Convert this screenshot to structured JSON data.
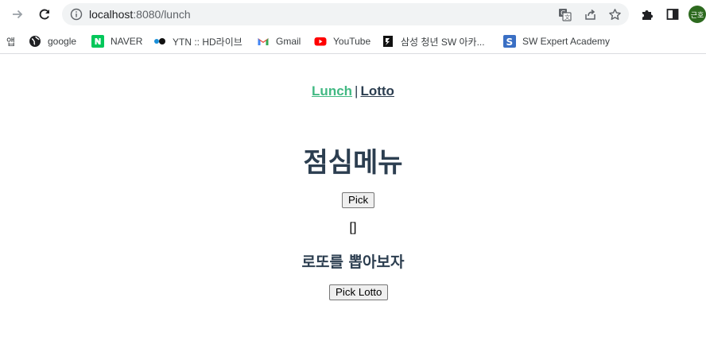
{
  "browser": {
    "url_host": "localhost",
    "url_rest": ":8080/lunch",
    "profile_initial": "근호",
    "icons": {
      "back": "arrow-left-icon",
      "forward": "arrow-right-icon",
      "reload": "reload-icon",
      "site_info": "info-icon",
      "translate": "translate-icon",
      "share": "share-icon",
      "bookmark": "star-icon",
      "extensions": "puzzle-icon",
      "sidepanel": "side-panel-icon"
    }
  },
  "bookmarks": [
    {
      "label": "앱",
      "icon": "apps-icon"
    },
    {
      "label": "google",
      "icon": "globe-icon"
    },
    {
      "label": "NAVER",
      "icon": "naver-icon"
    },
    {
      "label": "YTN :: HD라이브",
      "icon": "ytn-icon"
    },
    {
      "label": "Gmail",
      "icon": "gmail-icon"
    },
    {
      "label": "YouTube",
      "icon": "youtube-icon"
    },
    {
      "label": "삼성 청년 SW 아카...",
      "icon": "ssafy-icon"
    },
    {
      "label": "SW Expert Academy",
      "icon": "swea-icon"
    }
  ],
  "nav": {
    "lunch": "Lunch",
    "separator": "|",
    "lotto": "Lotto",
    "active_color": "#42b983",
    "text_color": "#2c3e50"
  },
  "lunch": {
    "title": "점심메뉴",
    "pick_button": "Pick",
    "result": "[]"
  },
  "lotto": {
    "title": "로또를 뽑아보자",
    "pick_button": "Pick Lotto"
  }
}
